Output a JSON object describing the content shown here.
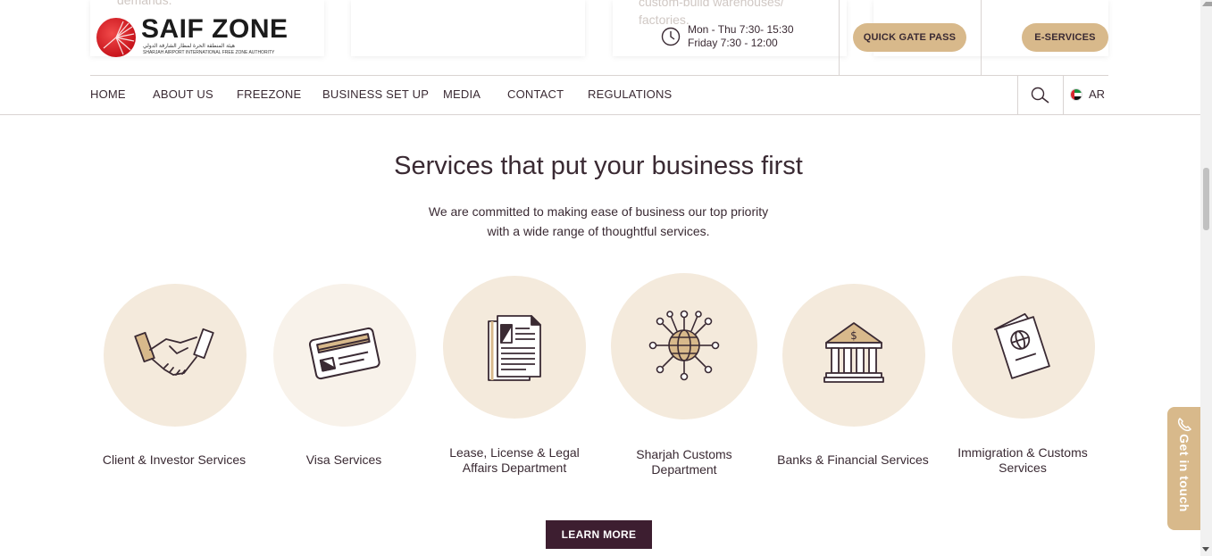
{
  "background_cards": {
    "card1_text": "demands.",
    "card3_text_line1": "custom-build warehouses/",
    "card3_text_line2": "factories."
  },
  "logo": {
    "name": "SAIF ZONE",
    "arabic": "هيئة المنطقة الحرة لمطار الشارقة الدولي",
    "subtitle": "SHARJAH AIRPORT INTERNATIONAL FREE ZONE AUTHORITY"
  },
  "hours": {
    "line1": "Mon - Thu 7:30- 15:30",
    "line2": "Friday 7:30 - 12:00"
  },
  "header_buttons": {
    "quick_gate_pass": "QUICK GATE PASS",
    "e_services": "E-SERVICES"
  },
  "nav": {
    "items": [
      "HOME",
      "ABOUT US",
      "FREEZONE",
      "BUSINESS SET UP",
      "MEDIA",
      "CONTACT",
      "REGULATIONS"
    ],
    "language": "AR"
  },
  "section": {
    "title": "Services that put your business first",
    "lead_line1": "We are committed to making ease of business our top priority",
    "lead_line2": "with a wide range of thoughtful services."
  },
  "services": [
    {
      "label_line1": "Client & Investor Services",
      "label_line2": "",
      "icon": "handshake-icon"
    },
    {
      "label_line1": "Visa Services",
      "label_line2": "",
      "icon": "card-icon"
    },
    {
      "label_line1": "Lease, License & Legal",
      "label_line2": "Affairs Department",
      "icon": "document-icon"
    },
    {
      "label_line1": "Sharjah Customs",
      "label_line2": "Department",
      "icon": "globe-network-icon"
    },
    {
      "label_line1": "Banks & Financial Services",
      "label_line2": "",
      "icon": "bank-icon"
    },
    {
      "label_line1": "Immigration & Customs",
      "label_line2": "Services",
      "icon": "passport-icon"
    }
  ],
  "learn_more": "LEARN MORE",
  "get_in_touch": "Get in touch",
  "colors": {
    "accent": "#d8b98b",
    "dark": "#3d1e30",
    "circle_bg": "#f4eadc",
    "text": "#3a2a33"
  }
}
